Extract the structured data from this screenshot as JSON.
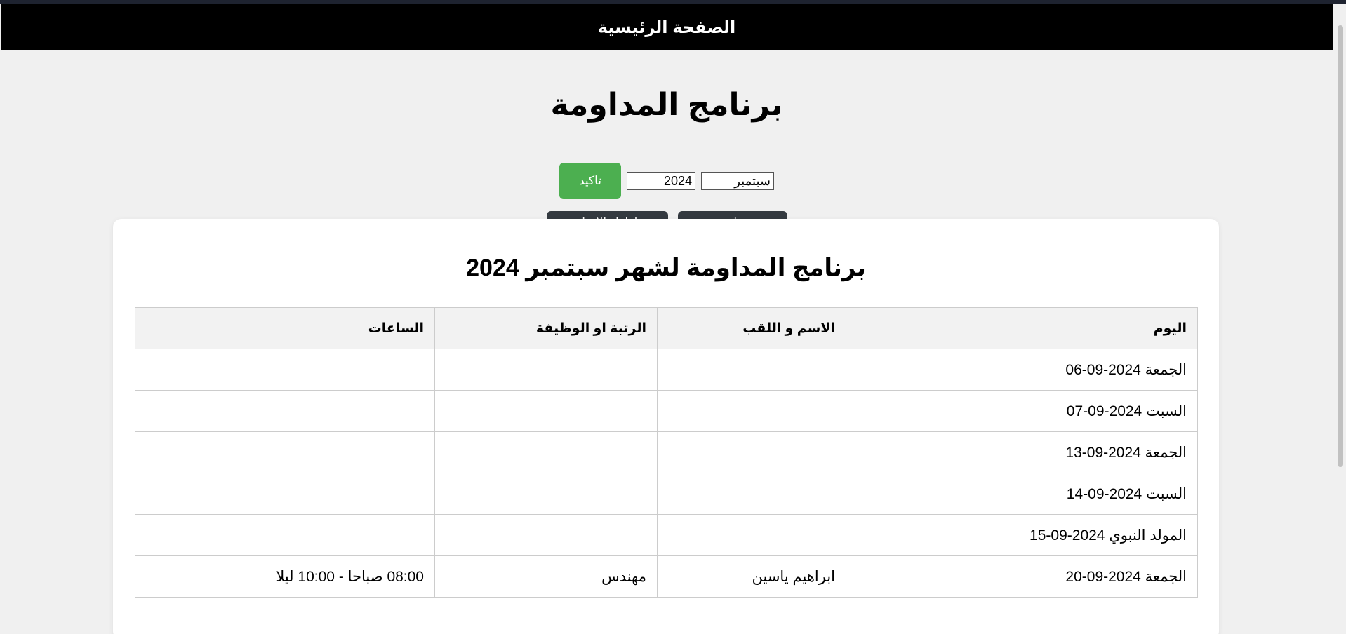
{
  "navbar": {
    "home_label": "الصفحة الرئيسية"
  },
  "page": {
    "title": "برنامج المداومة"
  },
  "controls": {
    "month_value": "سبتمبر",
    "year_value": "2024",
    "confirm_label": "تاكيد"
  },
  "actions": {
    "monthly_label": "مداومة الشهرية",
    "holidays_label": "اظهار الاعياد فقط"
  },
  "schedule": {
    "title": "برنامج المداومة لشهر سبتمبر 2024",
    "headers": [
      "اليوم",
      "الاسم و اللقب",
      "الرتبة او الوظيفة",
      "الساعات"
    ],
    "rows": [
      {
        "day": "الجمعة 2024-09-06",
        "name": "",
        "rank": "",
        "hours": ""
      },
      {
        "day": "السبت 2024-09-07",
        "name": "",
        "rank": "",
        "hours": ""
      },
      {
        "day": "الجمعة 2024-09-13",
        "name": "",
        "rank": "",
        "hours": ""
      },
      {
        "day": "السبت 2024-09-14",
        "name": "",
        "rank": "",
        "hours": ""
      },
      {
        "day": "المولد النبوي 2024-09-15",
        "name": "",
        "rank": "",
        "hours": ""
      },
      {
        "day": "الجمعة 2024-09-20",
        "name": "ابراهيم ياسين",
        "rank": "مهندس",
        "hours": "08:00 صباحا - 10:00 ليلا"
      }
    ]
  },
  "colors": {
    "navbar_bg": "#000000",
    "confirm_button": "#4caf50",
    "dark_button": "#343a40",
    "page_bg": "#f0f0f0"
  }
}
